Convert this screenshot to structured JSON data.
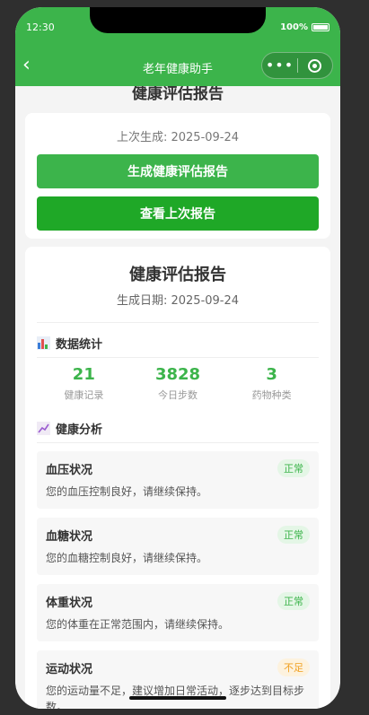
{
  "status": {
    "time": "12:30",
    "battery": "100%"
  },
  "nav": {
    "title": "老年健康助手"
  },
  "top_card": {
    "cut_title": "健康评估报告",
    "last_generated": "上次生成: 2025-09-24",
    "generate_label": "生成健康评估报告",
    "view_label": "查看上次报告"
  },
  "report": {
    "title": "健康评估报告",
    "date": "生成日期: 2025-09-24",
    "stats_heading": "数据统计",
    "stats": [
      {
        "value": "21",
        "label": "健康记录"
      },
      {
        "value": "3828",
        "label": "今日步数"
      },
      {
        "value": "3",
        "label": "药物种类"
      }
    ],
    "analysis_heading": "健康分析",
    "items": [
      {
        "title": "血压状况",
        "badge": "正常",
        "desc": "您的血压控制良好，请继续保持。"
      },
      {
        "title": "血糖状况",
        "badge": "正常",
        "desc": "您的血糖控制良好，请继续保持。"
      },
      {
        "title": "体重状况",
        "badge": "正常",
        "desc": "您的体重在正常范围内，请继续保持。"
      },
      {
        "title": "运动状况",
        "badge": "不足",
        "desc": "您的运动量不足，建议增加日常活动，逐步达到目标步数。"
      }
    ]
  },
  "colors": {
    "primary": "#3cb44b",
    "warn": "#f0a020"
  }
}
